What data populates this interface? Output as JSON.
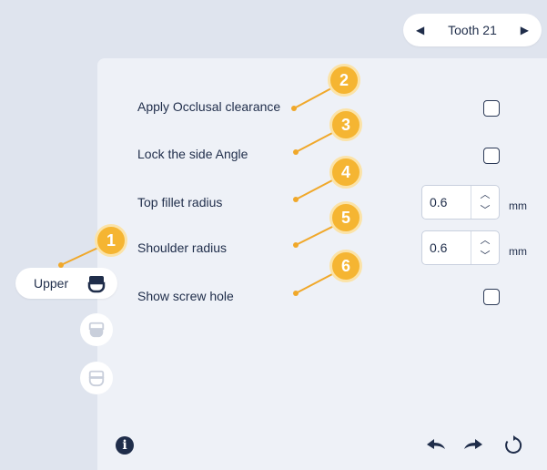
{
  "header": {
    "prev_arrow": "◀",
    "tooth_label": "Tooth 21",
    "next_arrow": "▶"
  },
  "jaw": {
    "selected_label": "Upper"
  },
  "settings": {
    "occlusal_label": "Apply Occlusal clearance",
    "lock_angle_label": "Lock the side Angle",
    "top_fillet_label": "Top fillet radius",
    "top_fillet_value": "0.6",
    "shoulder_label": "Shoulder radius",
    "shoulder_value": "0.6",
    "screw_hole_label": "Show screw hole",
    "unit": "mm",
    "occlusal_checked": false,
    "lock_angle_checked": false,
    "screw_hole_checked": false
  },
  "callouts": [
    "1",
    "2",
    "3",
    "4",
    "5",
    "6"
  ],
  "footer": {
    "info_label": "i"
  },
  "colors": {
    "background": "#dfe4ee",
    "panel": "#eef1f7",
    "accent": "#f5b532",
    "text": "#1f2d4a"
  }
}
